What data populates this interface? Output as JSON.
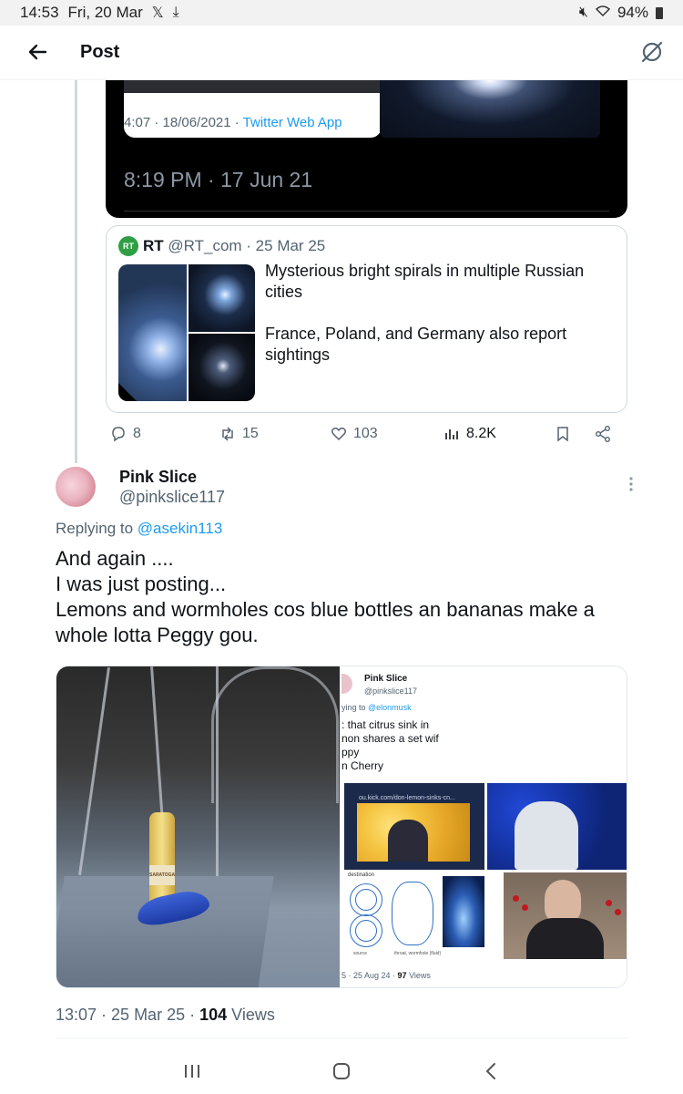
{
  "status_bar": {
    "time": "14:53",
    "date": "Fri, 20 Mar",
    "battery": "94%"
  },
  "header": {
    "title": "Post"
  },
  "quoted_media": {
    "inner_meta": "4:07 · 18/06/2021 · ",
    "inner_app": "Twitter Web App",
    "timestamp": "8:19 PM · 17 Jun 21"
  },
  "quote_card": {
    "avatar_text": "RT",
    "name": "RT",
    "handle_date": " @RT_com · 25 Mar 25",
    "text_p1": "Mysterious bright spirals in multiple Russian cities",
    "text_p2": "France, Poland, and Germany also report sightings"
  },
  "actions": {
    "replies": "8",
    "reposts": "15",
    "likes": "103",
    "views": "8.2K"
  },
  "tweet": {
    "display_name": "Pink Slice",
    "handle": "@pinkslice117",
    "replying_prefix": "Replying to ",
    "replying_to": "@asekin113",
    "body_line1": "And again ....",
    "body_line2": "I was just posting...",
    "body_line3": "Lemons and wormholes cos blue bottles an bananas make a whole lotta Peggy gou.",
    "time_date": "13:07 · 25 Mar 25 · ",
    "views_count": "104",
    "views_label": " Views"
  },
  "media": {
    "bottle_label": "SARATOGA",
    "screenshot": {
      "name": "Pink Slice",
      "handle": "@pinkslice117",
      "reply_prefix": "ying to ",
      "reply_mention": "@elonmusk",
      "text": ": that citrus sink in\nnon shares a set wif\nppy\nn Cherry",
      "grid_url": "ou.kick.com/don-lemon-sinks-cn...",
      "label_destination": "destination",
      "label_source": "source",
      "label_throat": "throat, wormhole (fluid)",
      "footer_prefix": "5 · 25 Aug 24 · ",
      "footer_views": "97",
      "footer_suffix": " Views"
    }
  },
  "colors": {
    "accent": "#1d9bf0",
    "secondary_text": "#536471",
    "border": "#cfd9de"
  }
}
